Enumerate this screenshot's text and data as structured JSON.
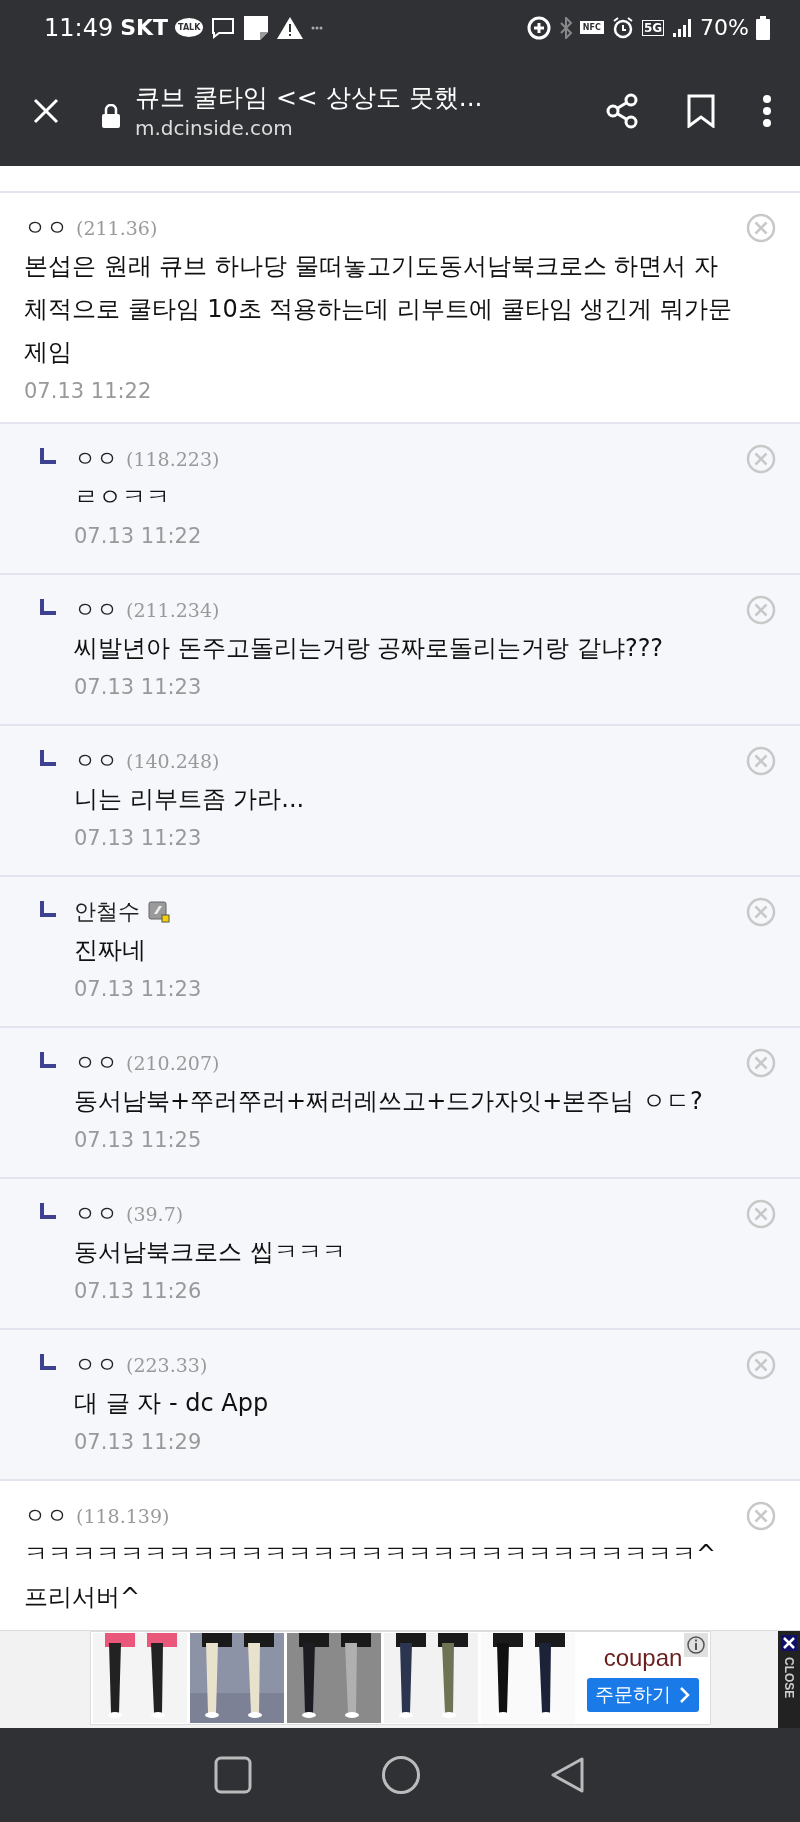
{
  "status_bar": {
    "time": "11:49",
    "carrier": "SKT",
    "talk_label": "TALK",
    "nfc_label": "NFC",
    "network": "5G",
    "battery": "70%"
  },
  "toolbar": {
    "title": "큐브 쿨타임 << 상상도 못했...",
    "url": "m.dcinside.com"
  },
  "comments": [
    {
      "kind": "comment",
      "name": "ㅇㅇ",
      "ip": "(211.36)",
      "member_icon": false,
      "text": "본섭은 원래 큐브 하나당 물떠놓고기도동서남북크로스 하면서 자체적으로 쿨타임 10초 적용하는데 리부트에 쿨타임 생긴게 뭐가문제임",
      "time": "07.13 11:22"
    },
    {
      "kind": "reply",
      "name": "ㅇㅇ",
      "ip": "(118.223)",
      "member_icon": false,
      "text": "ㄹㅇㅋㅋ",
      "time": "07.13 11:22"
    },
    {
      "kind": "reply",
      "name": "ㅇㅇ",
      "ip": "(211.234)",
      "member_icon": false,
      "text": "씨발년아 돈주고돌리는거랑 공짜로돌리는거랑 같냐???",
      "time": "07.13 11:23"
    },
    {
      "kind": "reply",
      "name": "ㅇㅇ",
      "ip": "(140.248)",
      "member_icon": false,
      "text": "니는 리부트좀 가라...",
      "time": "07.13 11:23"
    },
    {
      "kind": "reply",
      "name": "안철수",
      "member_icon": true,
      "text": "진짜네",
      "time": "07.13 11:23"
    },
    {
      "kind": "reply",
      "name": "ㅇㅇ",
      "ip": "(210.207)",
      "member_icon": false,
      "text": "동서남북+쭈러쭈러+쩌러레쓰고+드가자잇+본주님 ㅇㄷ?",
      "time": "07.13 11:25"
    },
    {
      "kind": "reply",
      "name": "ㅇㅇ",
      "ip": "(39.7)",
      "member_icon": false,
      "text": "동서남북크로스 씹ㅋㅋㅋ",
      "time": "07.13 11:26"
    },
    {
      "kind": "reply",
      "name": "ㅇㅇ",
      "ip": "(223.33)",
      "member_icon": false,
      "text": "대 글 자 - dc App",
      "time": "07.13 11:29"
    },
    {
      "kind": "comment",
      "name": "ㅇㅇ",
      "ip": "(118.139)",
      "member_icon": false,
      "text": "ㅋㅋㅋㅋㅋㅋㅋㅋㅋㅋㅋㅋㅋㅋㅋㅋㅋㅋㅋㅋㅋㅋㅋㅋㅋㅋㅋㅋ^프리서버^"
    }
  ],
  "ad": {
    "logo": "coupan",
    "order_button": "주문하기",
    "close": "CLOSE"
  }
}
